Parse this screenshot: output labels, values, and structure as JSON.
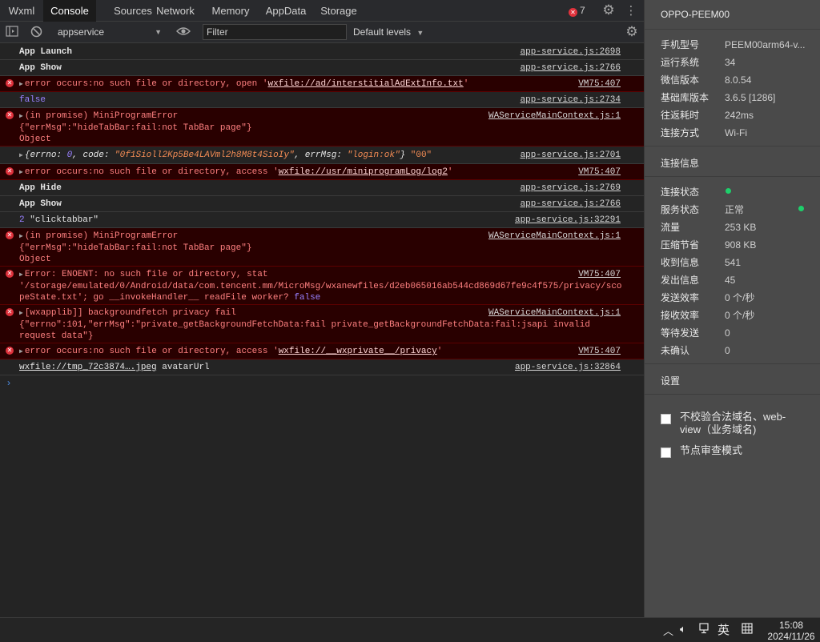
{
  "tabs": [
    {
      "label": "Wxml"
    },
    {
      "label": "Console"
    },
    {
      "label": "Sources"
    },
    {
      "label": "Network"
    },
    {
      "label": "Memory"
    },
    {
      "label": "AppData"
    },
    {
      "label": "Storage"
    }
  ],
  "active_tab": "Console",
  "error_count": "7",
  "toolbar": {
    "context": "appservice",
    "filter_placeholder": "Filter",
    "levels": "Default levels"
  },
  "logs": [
    {
      "text": "App Launch",
      "source": "app-service.js:2698"
    },
    {
      "text": "App Show",
      "source": "app-service.js:2766"
    },
    {
      "pre": "error occurs:no such file or directory, open '",
      "link": "wxfile://ad/interstitialAdExtInfo.txt",
      "post": "'",
      "source": "VM75:407"
    },
    {
      "text": "false",
      "source": "app-service.js:2734"
    },
    {
      "lines": [
        "(in promise) MiniProgramError",
        "{\"errMsg\":\"hideTabBar:fail:not TabBar page\"}",
        "Object"
      ],
      "source": "WAServiceMainContext.js:1"
    },
    {
      "errno_key": "errno",
      "errno_val": "0",
      "code_key": "code",
      "code_val": "\"0f1Sioll2Kp5Be4LAVml2h8M8t4SioIy\"",
      "msg_key": "errMsg",
      "msg_val": "\"login:ok\"",
      "tail": "\"00\"",
      "source": "app-service.js:2701"
    },
    {
      "pre": "error occurs:no such file or directory, access '",
      "link": "wxfile://usr/miniprogramLog/log2",
      "post": "'",
      "source": "VM75:407"
    },
    {
      "text": "App Hide",
      "source": "app-service.js:2769"
    },
    {
      "text": "App Show",
      "source": "app-service.js:2766"
    },
    {
      "num": "2",
      "str": "\"clicktabbar\"",
      "source": "app-service.js:32291"
    },
    {
      "lines": [
        "(in promise) MiniProgramError",
        "{\"errMsg\":\"hideTabBar:fail:not TabBar page\"}",
        "Object"
      ],
      "source": "WAServiceMainContext.js:1"
    },
    {
      "lines": [
        "Error: ENOENT: no such file or directory, stat",
        "'/storage/emulated/0/Android/data/com.tencent.mm/MicroMsg/wxanewfiles/d2eb065016ab544cd869d67fe9c4f575/privacy/sco",
        "peState.txt'; go __invokeHandler__ readFile worker? "
      ],
      "bool": "false",
      "source": "VM75:407"
    },
    {
      "lines": [
        "[wxapplib]] backgroundfetch privacy fail",
        "{\"errno\":101,\"errMsg\":\"private_getBackgroundFetchData:fail private_getBackgroundFetchData:fail:jsapi invalid",
        "request data\"}"
      ],
      "source": "WAServiceMainContext.js:1"
    },
    {
      "pre": "error occurs:no such file or directory, access '",
      "link": "wxfile://__wxprivate__/privacy",
      "post": "'",
      "source": "VM75:407"
    },
    {
      "link": "wxfile://tmp_72c3874….jpeg",
      "post": " avatarUrl",
      "source": "app-service.js:32864"
    }
  ],
  "device": {
    "name": "OPPO-PEEM00",
    "rows": [
      {
        "k": "手机型号",
        "v": "PEEM00arm64-v..."
      },
      {
        "k": "运行系统",
        "v": "34"
      },
      {
        "k": "微信版本",
        "v": "8.0.54"
      },
      {
        "k": "基础库版本",
        "v": "3.6.5 [1286]"
      },
      {
        "k": "往返耗时",
        "v": "242ms"
      },
      {
        "k": "连接方式",
        "v": "Wi-Fi"
      }
    ]
  },
  "connection": {
    "title": "连接信息",
    "rows": [
      {
        "k": "连接状态",
        "v": ""
      },
      {
        "k": "服务状态",
        "v": "正常"
      },
      {
        "k": "流量",
        "v": "253 KB"
      },
      {
        "k": "压缩节省",
        "v": "908 KB"
      },
      {
        "k": "收到信息",
        "v": "541"
      },
      {
        "k": "发出信息",
        "v": "45"
      },
      {
        "k": "发送效率",
        "v": "0 个/秒"
      },
      {
        "k": "接收效率",
        "v": "0 个/秒"
      },
      {
        "k": "等待发送",
        "v": "0"
      },
      {
        "k": "未确认",
        "v": "0"
      }
    ]
  },
  "settings": {
    "title": "设置",
    "options": [
      {
        "label": "不校验合法域名、web-view（业务域名)",
        "checked": false
      },
      {
        "label": "节点审查模式",
        "checked": false
      }
    ]
  },
  "taskbar": {
    "ime": "英",
    "time": "15:08",
    "date": "2024/11/26"
  },
  "colors": {
    "error_bg": "#290000",
    "error_text": "#ff8080",
    "status_green": "#1ecf6b",
    "accent_blue": "#4d8ee8"
  }
}
